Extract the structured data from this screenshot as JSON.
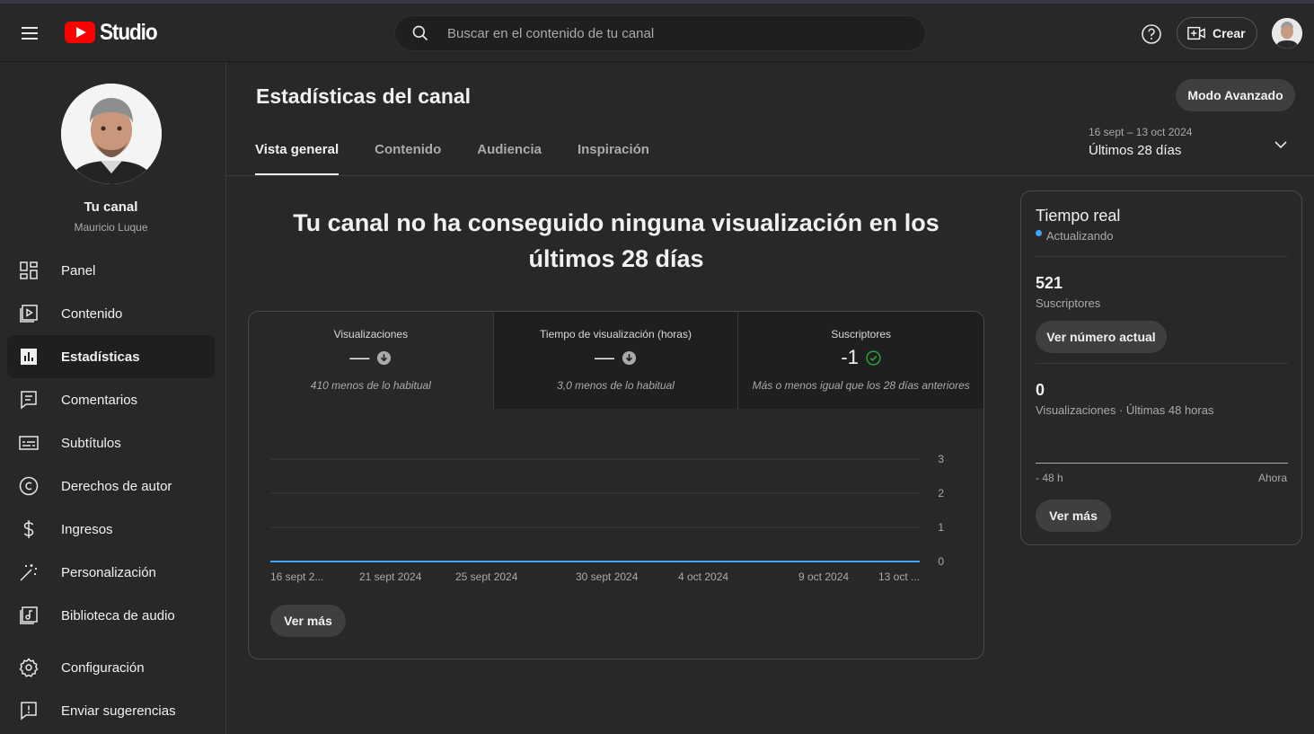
{
  "header": {
    "logo_text": "Studio",
    "search_placeholder": "Buscar en el contenido de tu canal",
    "create_label": "Crear"
  },
  "sidebar": {
    "channel_title": "Tu canal",
    "channel_name": "Mauricio Luque",
    "items": [
      {
        "label": "Panel",
        "icon": "dashboard-icon"
      },
      {
        "label": "Contenido",
        "icon": "content-icon"
      },
      {
        "label": "Estadísticas",
        "icon": "analytics-icon"
      },
      {
        "label": "Comentarios",
        "icon": "comments-icon"
      },
      {
        "label": "Subtítulos",
        "icon": "subtitles-icon"
      },
      {
        "label": "Derechos de autor",
        "icon": "copyright-icon"
      },
      {
        "label": "Ingresos",
        "icon": "monetization-icon"
      },
      {
        "label": "Personalización",
        "icon": "customization-icon"
      },
      {
        "label": "Biblioteca de audio",
        "icon": "audio-library-icon"
      },
      {
        "label": "Configuración",
        "icon": "settings-icon"
      },
      {
        "label": "Enviar sugerencias",
        "icon": "feedback-icon"
      }
    ],
    "active_item": "Estadísticas"
  },
  "main": {
    "title": "Estadísticas del canal",
    "advanced_mode_label": "Modo Avanzado",
    "tabs": [
      {
        "label": "Vista general",
        "active": true
      },
      {
        "label": "Contenido",
        "active": false
      },
      {
        "label": "Audiencia",
        "active": false
      },
      {
        "label": "Inspiración",
        "active": false
      }
    ],
    "date_range": {
      "dates": "16 sept – 13 oct 2024",
      "period": "Últimos 28 días"
    },
    "headline": "Tu canal no ha conseguido ninguna visualización en los últimos 28 días",
    "metrics": [
      {
        "label": "Visualizaciones",
        "value": "—",
        "trend": "down",
        "note": "410 menos de lo habitual"
      },
      {
        "label": "Tiempo de visualización (horas)",
        "value": "—",
        "trend": "down",
        "note": "3,0 menos de lo habitual"
      },
      {
        "label": "Suscriptores",
        "value": "-1",
        "trend": "same",
        "note": "Más o menos igual que los 28 días anteriores"
      }
    ],
    "see_more_label": "Ver más"
  },
  "chart_data": {
    "type": "line",
    "x": [
      "16 sept 2...",
      "21 sept 2024",
      "25 sept 2024",
      "30 sept 2024",
      "4 oct 2024",
      "9 oct 2024",
      "13 oct ..."
    ],
    "series": [
      {
        "values": [
          0,
          0,
          0,
          0,
          0,
          0,
          0
        ]
      }
    ],
    "yticks": [
      "0",
      "1",
      "2",
      "3"
    ],
    "ylim": [
      0,
      3
    ],
    "grid": true,
    "line_color": "#3ea6ff"
  },
  "realtime": {
    "title": "Tiempo real",
    "status": "Actualizando",
    "subscribers_value": "521",
    "subscribers_label": "Suscriptores",
    "current_number_label": "Ver número actual",
    "views_value": "0",
    "views_label": "Visualizaciones · Últimas 48 horas",
    "axis_start": "- 48 h",
    "axis_end": "Ahora",
    "see_more_label": "Ver más",
    "status_color": "#3ea6ff"
  }
}
